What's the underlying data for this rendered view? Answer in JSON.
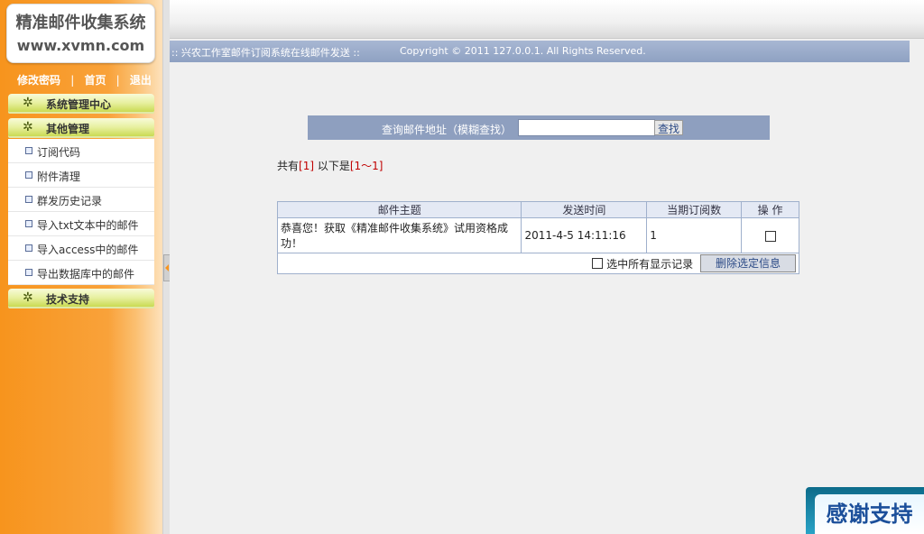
{
  "logo": {
    "line1": "精准邮件收集系统",
    "line2": "www.xvmn.com"
  },
  "top_links": {
    "change_password": "修改密码",
    "home": "首页",
    "logout": "退出",
    "separator": "|"
  },
  "menu": {
    "system_center": "系统管理中心",
    "other_management": "其他管理",
    "sub_items": [
      "订阅代码",
      "附件清理",
      "群发历史记录",
      "导入txt文本中的邮件",
      "导入access中的邮件",
      "导出数据库中的邮件"
    ],
    "tech_support": "技术支持",
    "icon": "gear-icon"
  },
  "status_bar": {
    "left": ":: 兴农工作室邮件订阅系统在线邮件发送 ::",
    "right": "Copyright © 2011 127.0.0.1. All Rights Reserved."
  },
  "search": {
    "label": "查询邮件地址（模糊查找）",
    "value": "",
    "button": "查找"
  },
  "summary": {
    "prefix": "共有",
    "total": "[1]",
    "middle": " 以下是",
    "range": "[1～1]"
  },
  "table": {
    "headers": [
      "邮件主题",
      "发送时间",
      "当期订阅数",
      "操 作"
    ],
    "rows": [
      {
        "subject": "恭喜您！获取《精准邮件收集系统》试用资格成功！",
        "time": "2011-4-5 14:11:16",
        "subscribers": "1",
        "checked": false
      }
    ],
    "select_all_label": "选中所有显示记录",
    "delete_button": "删除选定信息"
  },
  "thanks_badge": "感谢支持",
  "colors": {
    "sidebar_orange": "#f7941d",
    "menu_green": "#c9da52",
    "status_blue": "#8ea1c2",
    "highlight_red": "#c00000"
  }
}
